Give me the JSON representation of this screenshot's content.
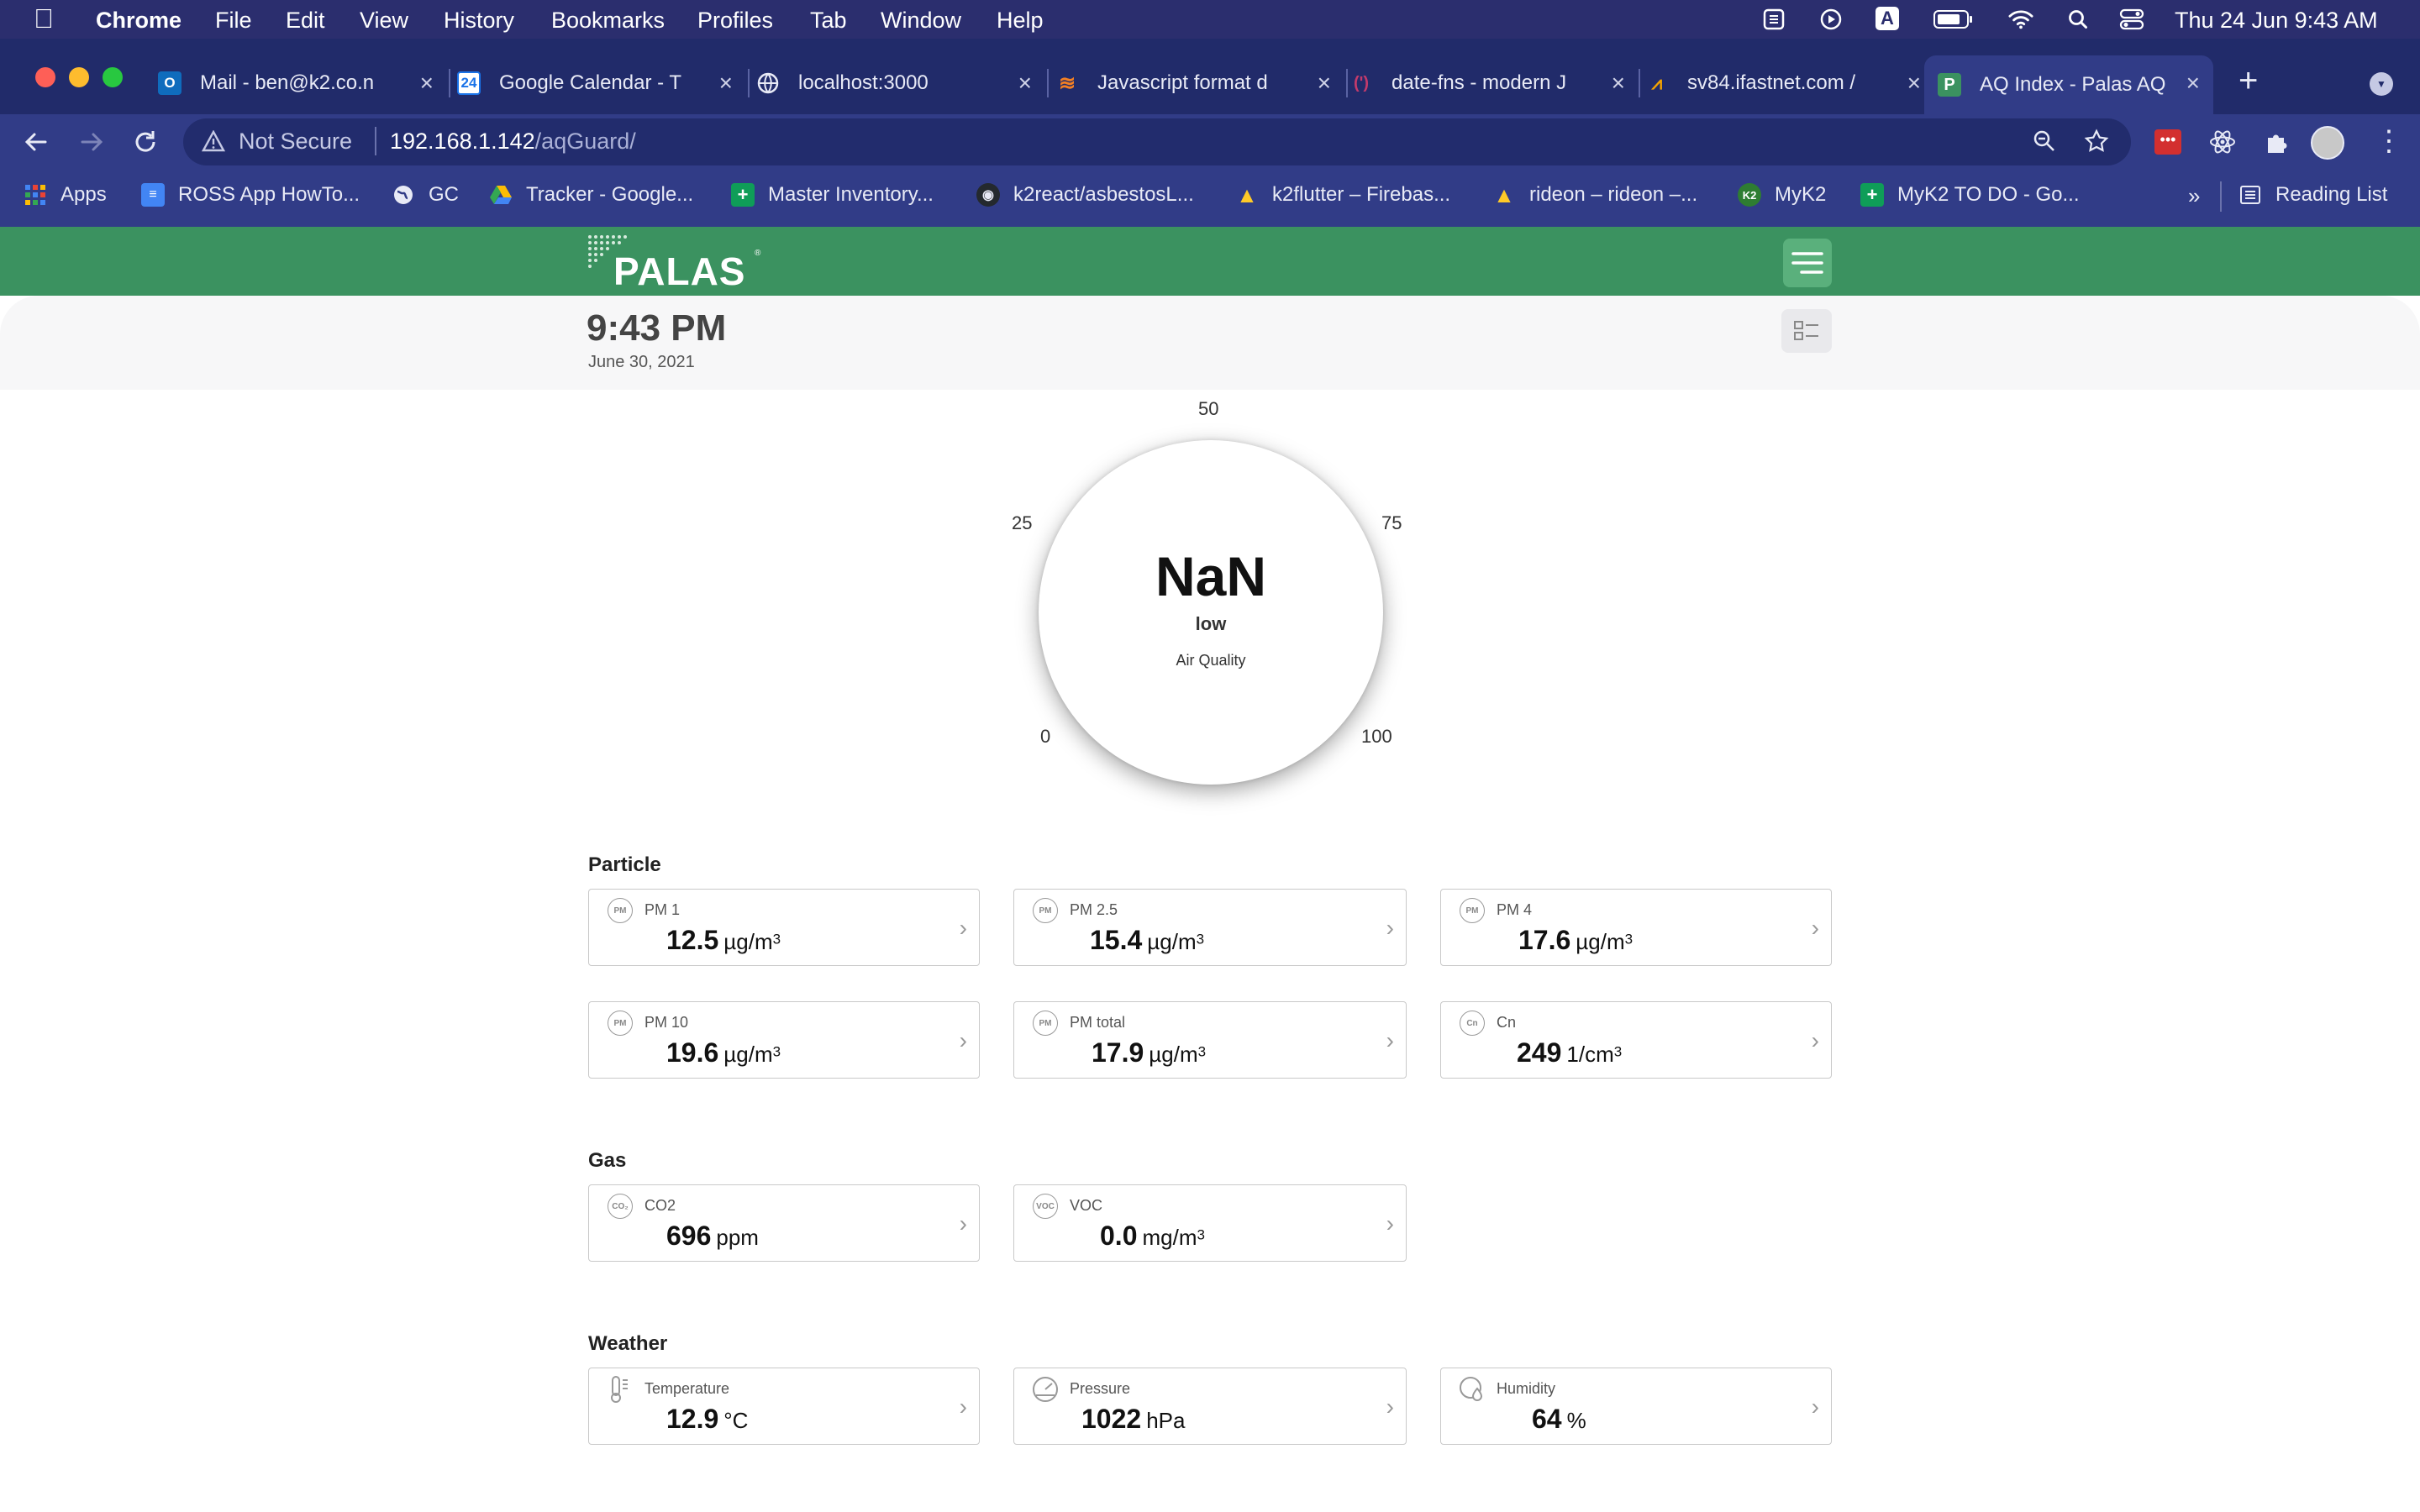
{
  "menubar": {
    "items": [
      "Chrome",
      "File",
      "Edit",
      "View",
      "History",
      "Bookmarks",
      "Profiles",
      "Tab",
      "Window",
      "Help"
    ],
    "clock": "Thu 24 Jun  9:43 AM"
  },
  "tabs": [
    {
      "title": "Mail - ben@k2.co.n",
      "icon": "outlook-icon"
    },
    {
      "title": "Google Calendar - T",
      "icon": "calendar-icon"
    },
    {
      "title": "localhost:3000",
      "icon": "globe-icon"
    },
    {
      "title": "Javascript format d",
      "icon": "stackoverflow-icon"
    },
    {
      "title": "date-fns - modern J",
      "icon": "datefns-icon"
    },
    {
      "title": "sv84.ifastnet.com /",
      "icon": "cpanel-icon"
    },
    {
      "title": "AQ Index - Palas AQ",
      "icon": "palas-icon",
      "active": true
    }
  ],
  "omnibox": {
    "security": "Not Secure",
    "host": "192.168.1.142",
    "path": "/aqGuard/"
  },
  "bookmarks": [
    {
      "label": "Apps",
      "icon": "apps-grid-icon"
    },
    {
      "label": "ROSS App HowTo...",
      "icon": "docs-icon"
    },
    {
      "label": "GC",
      "icon": "globe-icon"
    },
    {
      "label": "Tracker - Google...",
      "icon": "drive-icon"
    },
    {
      "label": "Master Inventory...",
      "icon": "sheets-icon"
    },
    {
      "label": "k2react/asbestosL...",
      "icon": "github-icon"
    },
    {
      "label": "k2flutter – Firebas...",
      "icon": "firebase-icon"
    },
    {
      "label": "rideon – rideon –...",
      "icon": "firebase-icon"
    },
    {
      "label": "MyK2",
      "icon": "k2-icon"
    },
    {
      "label": "MyK2 TO DO - Go...",
      "icon": "sheets-icon"
    }
  ],
  "bookmarks_more": "»",
  "reading_list": "Reading List",
  "app": {
    "logo": "PALAS",
    "time": "9:43 PM",
    "date": "June 30, 2021"
  },
  "gauge": {
    "value": "NaN",
    "level": "low",
    "caption": "Air Quality",
    "ticks": [
      "0",
      "25",
      "50",
      "75",
      "100"
    ]
  },
  "sections": {
    "particle": "Particle",
    "gas": "Gas",
    "weather": "Weather"
  },
  "particle": [
    {
      "label": "PM 1",
      "value": "12.5",
      "unit": "µg/m",
      "sup": "3",
      "icon": "pm1-icon"
    },
    {
      "label": "PM 2.5",
      "value": "15.4",
      "unit": "µg/m",
      "sup": "3",
      "icon": "pm25-icon"
    },
    {
      "label": "PM 4",
      "value": "17.6",
      "unit": "µg/m",
      "sup": "3",
      "icon": "pm4-icon"
    },
    {
      "label": "PM 10",
      "value": "19.6",
      "unit": "µg/m",
      "sup": "3",
      "icon": "pm10-icon"
    },
    {
      "label": "PM total",
      "value": "17.9",
      "unit": "µg/m",
      "sup": "3",
      "icon": "pmtotal-icon"
    },
    {
      "label": "Cn",
      "value": "249",
      "unit": "1/cm",
      "sup": "3",
      "icon": "cn-icon"
    }
  ],
  "gas": [
    {
      "label": "CO2",
      "value": "696",
      "unit": "ppm",
      "sup": "",
      "icon": "co2-icon"
    },
    {
      "label": "VOC",
      "value": "0.0",
      "unit": "mg/m",
      "sup": "3",
      "icon": "voc-icon"
    }
  ],
  "weather": [
    {
      "label": "Temperature",
      "value": "12.9",
      "unit": "°C",
      "sup": "",
      "icon": "thermometer-icon"
    },
    {
      "label": "Pressure",
      "value": "1022",
      "unit": "hPa",
      "sup": "",
      "icon": "pressure-gauge-icon"
    },
    {
      "label": "Humidity",
      "value": "64",
      "unit": "%",
      "sup": "",
      "icon": "humidity-icon"
    }
  ],
  "colors": {
    "brand_green": "#3b9260",
    "chrome_bg": "#313c87",
    "menubar_bg": "#2b2e6e"
  }
}
